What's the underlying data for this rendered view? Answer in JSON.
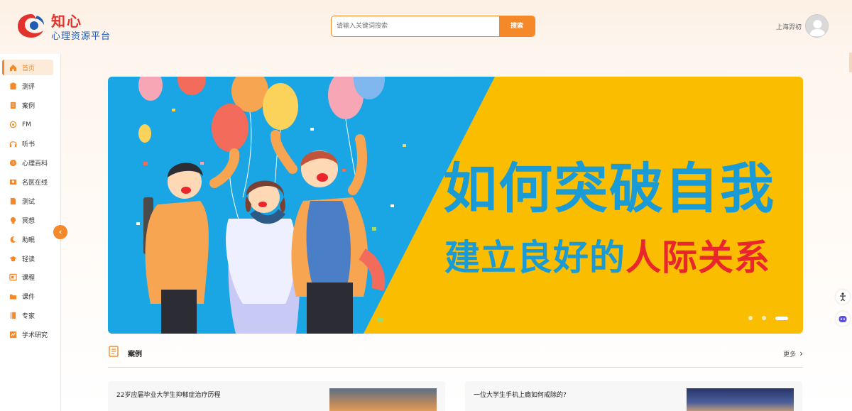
{
  "header": {
    "logo_title": "知心",
    "logo_subtitle": "心理资源平台",
    "search_placeholder": "请输入关键词搜索",
    "search_button": "搜索",
    "user_name": "上海羿初"
  },
  "sidebar": {
    "items": [
      {
        "label": "首页",
        "icon": "home-icon",
        "active": true
      },
      {
        "label": "测评",
        "icon": "clipboard-icon"
      },
      {
        "label": "案例",
        "icon": "document-icon"
      },
      {
        "label": "FM",
        "icon": "radio-icon"
      },
      {
        "label": "听书",
        "icon": "headphones-icon"
      },
      {
        "label": "心理百科",
        "icon": "question-icon"
      },
      {
        "label": "名医在线",
        "icon": "doctor-icon"
      },
      {
        "label": "测试",
        "icon": "test-icon"
      },
      {
        "label": "冥想",
        "icon": "meditation-icon"
      },
      {
        "label": "助眠",
        "icon": "moon-icon"
      },
      {
        "label": "轻读",
        "icon": "graduation-cap-icon"
      },
      {
        "label": "课程",
        "icon": "course-icon"
      },
      {
        "label": "课件",
        "icon": "folder-icon"
      },
      {
        "label": "专家",
        "icon": "book-icon"
      },
      {
        "label": "学术研究",
        "icon": "research-icon"
      }
    ]
  },
  "banner": {
    "line1": "如何突破自我",
    "line2_prefix": "建立良好的",
    "line2_highlight": "人际关系",
    "slide_count": 3,
    "active_slide": 3
  },
  "section": {
    "title": "案例",
    "more": "更多"
  },
  "cards": [
    {
      "title": "22岁应届毕业大学生抑郁症治疗历程"
    },
    {
      "title": "一位大学生手机上瘾如何戒除的?"
    }
  ],
  "colors": {
    "accent": "#f5892a",
    "banner_blue": "#1a9bd6",
    "banner_yellow": "#fbbd00",
    "highlight_red": "#e8262b"
  }
}
